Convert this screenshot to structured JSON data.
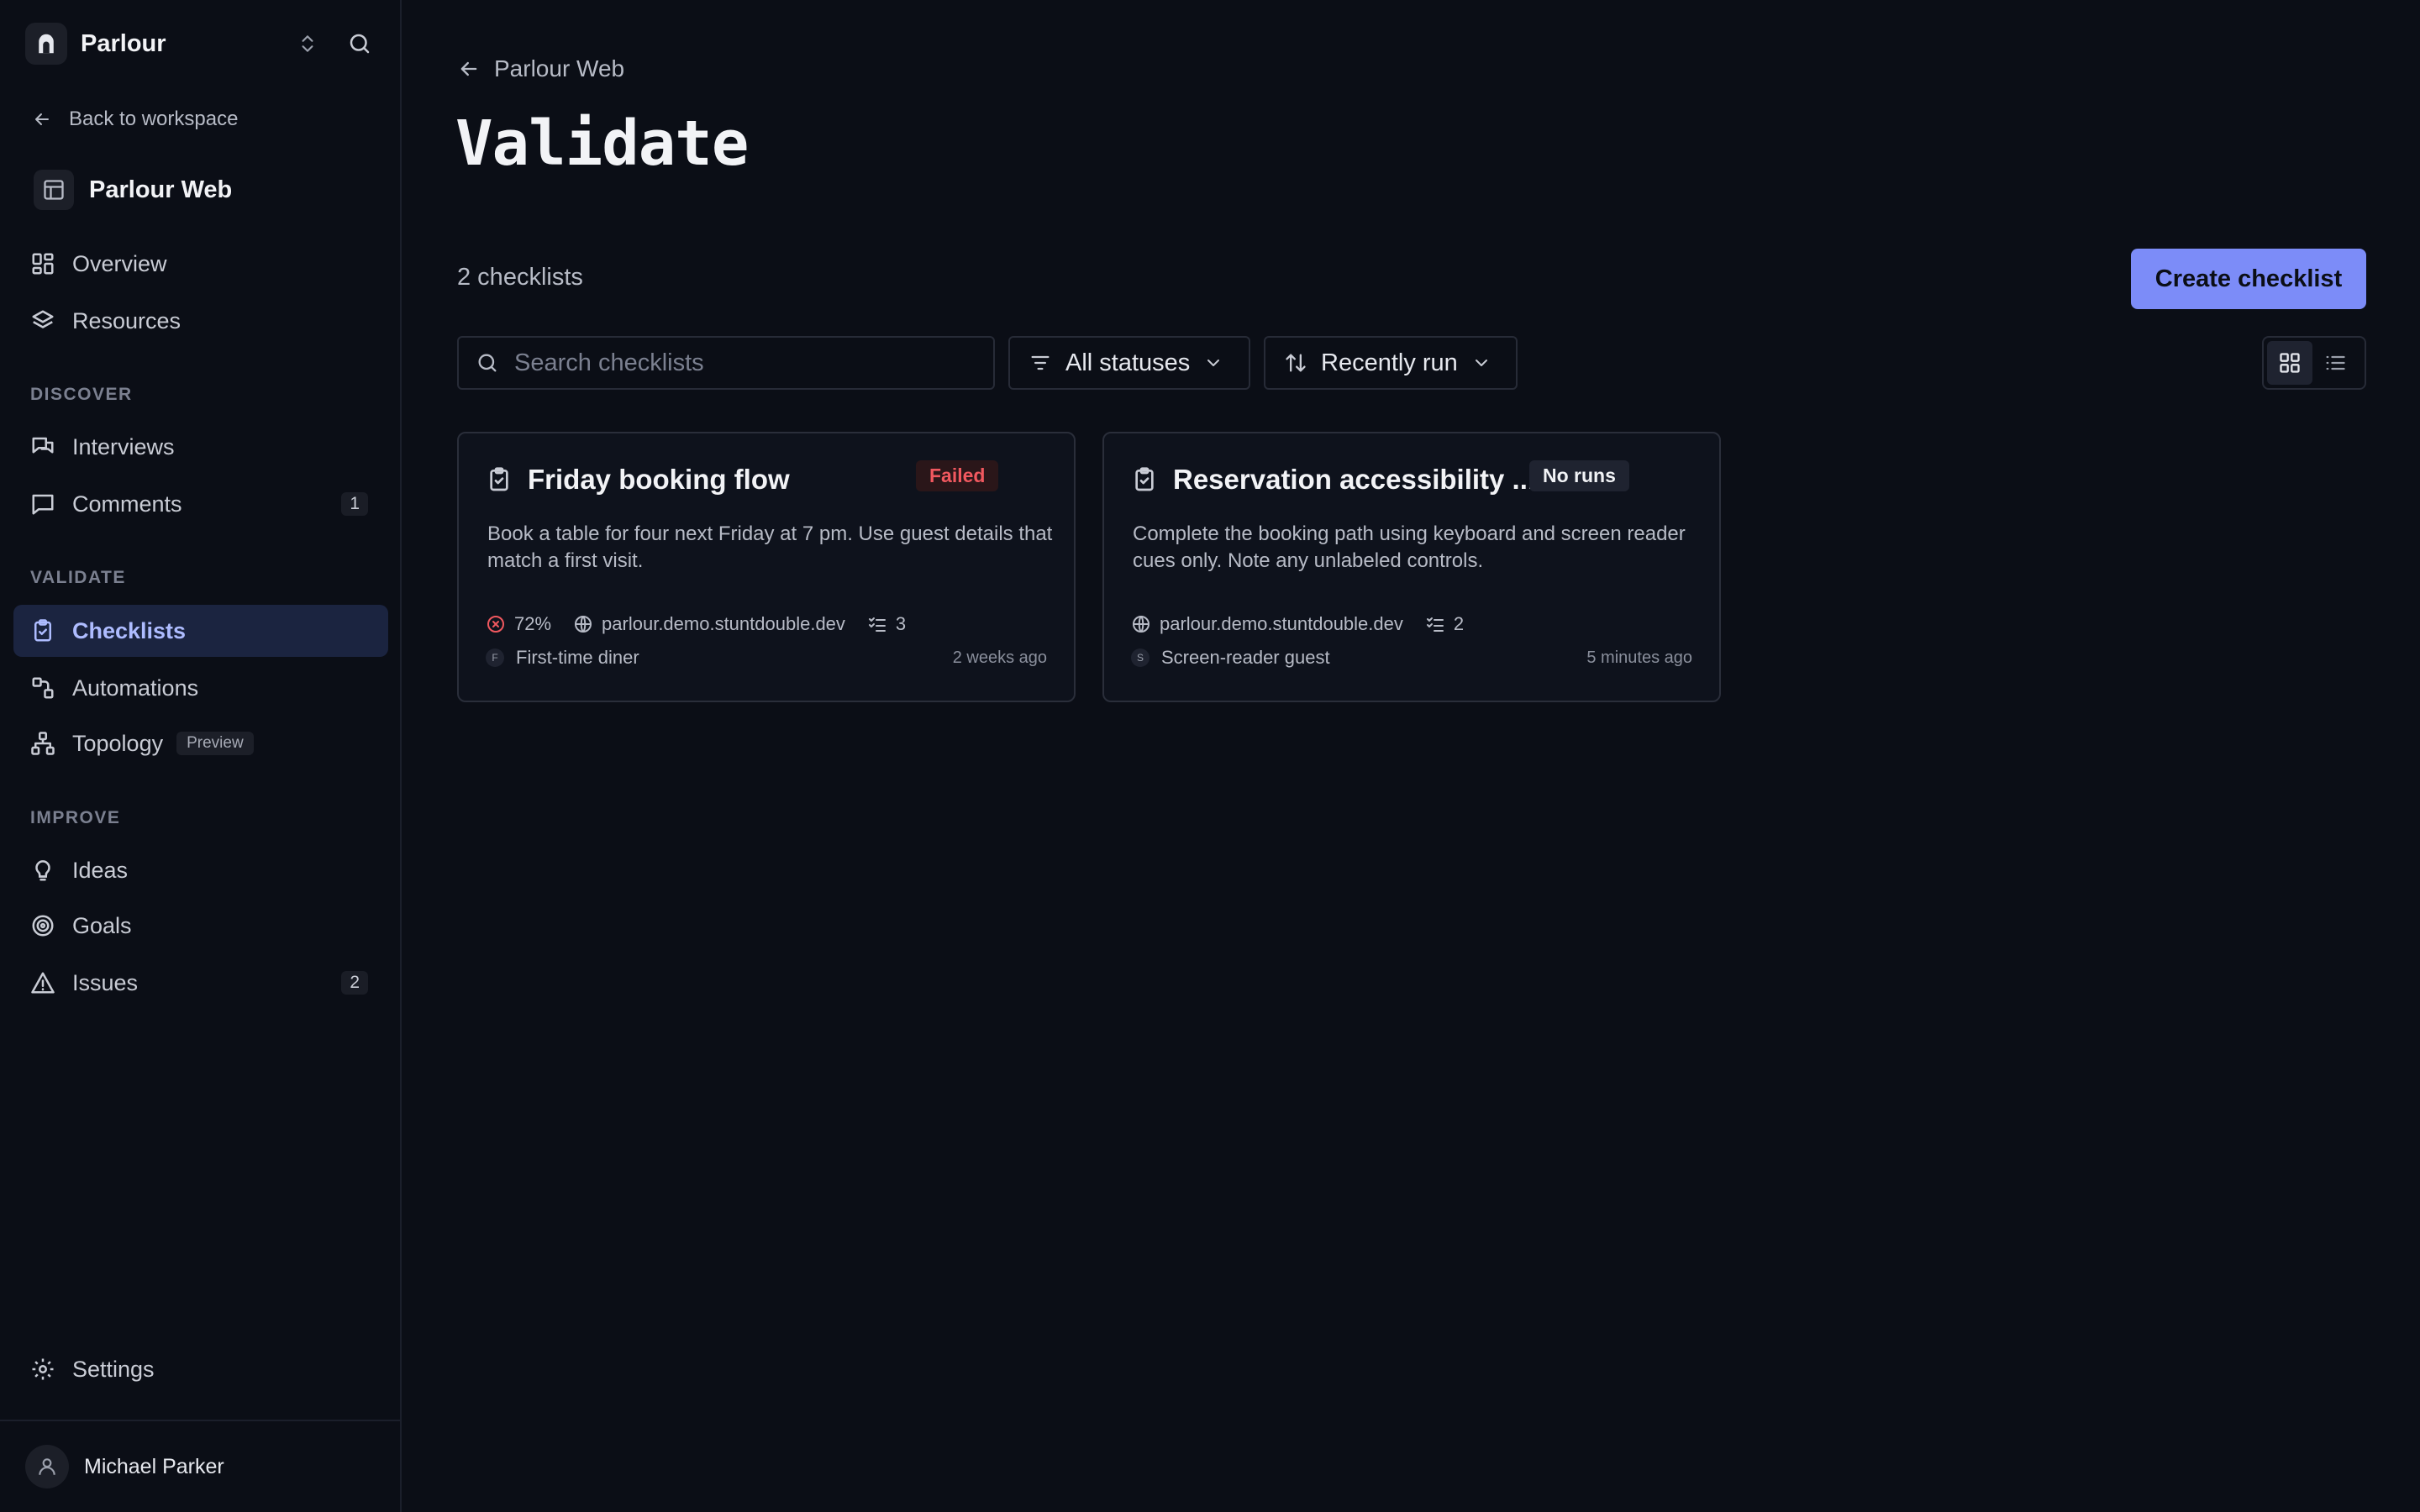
{
  "workspace": {
    "name": "Parlour"
  },
  "sidebar": {
    "back_label": "Back to workspace",
    "project_name": "Parlour Web",
    "top_items": [
      {
        "label": "Overview"
      },
      {
        "label": "Resources"
      }
    ],
    "discover_label": "DISCOVER",
    "discover_items": [
      {
        "label": "Interviews"
      },
      {
        "label": "Comments",
        "count": "1"
      }
    ],
    "validate_label": "VALIDATE",
    "validate_items": [
      {
        "label": "Checklists"
      },
      {
        "label": "Automations"
      },
      {
        "label": "Topology",
        "badge": "Preview"
      }
    ],
    "improve_label": "IMPROVE",
    "improve_items": [
      {
        "label": "Ideas"
      },
      {
        "label": "Goals"
      },
      {
        "label": "Issues",
        "count": "2"
      }
    ],
    "settings_label": "Settings",
    "user_name": "Michael Parker"
  },
  "main": {
    "breadcrumb": "Parlour Web",
    "title": "Validate",
    "count_text": "2 checklists",
    "create_button": "Create checklist",
    "search_placeholder": "Search checklists",
    "status_filter": "All statuses",
    "sort": "Recently run",
    "view_mode": "grid"
  },
  "cards": [
    {
      "title": "Friday booking flow",
      "status": "Failed",
      "description": "Book a table for four next Friday at 7 pm. Use guest details that match a first visit.",
      "score": "72%",
      "url": "parlour.demo.stuntdouble.dev",
      "steps": "3",
      "persona_initial": "F",
      "persona": "First-time diner",
      "time": "2 weeks ago"
    },
    {
      "title": "Reservation accessibility ...",
      "status": "No runs",
      "description": "Complete the booking path using keyboard and screen reader cues only. Note any unlabeled controls.",
      "url": "parlour.demo.stuntdouble.dev",
      "steps": "2",
      "persona_initial": "S",
      "persona": "Screen-reader guest",
      "time": "5 minutes ago"
    }
  ],
  "colors": {
    "background": "#0b0e16",
    "accent": "#7c8cf8",
    "active_nav_bg": "#1b2440",
    "failed": "#f0585f"
  }
}
